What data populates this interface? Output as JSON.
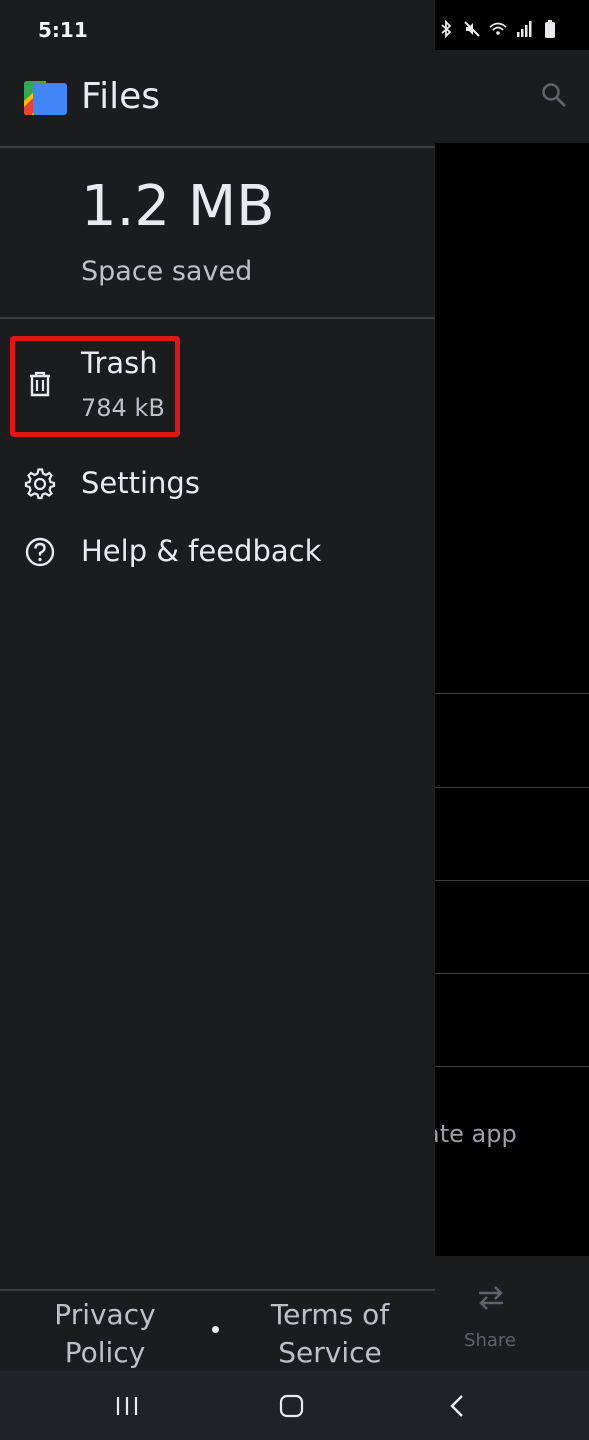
{
  "status_bar": {
    "time": "5:11",
    "icons": [
      "bluetooth-icon",
      "mute-icon",
      "wifi-icon",
      "signal-icon",
      "battery-icon"
    ]
  },
  "drawer": {
    "app_title": "Files",
    "storage": {
      "value": "1.2 MB",
      "label": "Space saved"
    },
    "items": [
      {
        "icon": "trash-icon",
        "label": "Trash",
        "sublabel": "784 kB"
      },
      {
        "icon": "settings-gear-icon",
        "label": "Settings"
      },
      {
        "icon": "help-circle-icon",
        "label": "Help & feedback"
      }
    ],
    "footer": {
      "privacy": "Privacy Policy",
      "terms": "Terms of Service"
    }
  },
  "background_app": {
    "partial_text": "ate app",
    "share_label": "Share"
  },
  "colors": {
    "drawer_bg": "#1a1c1e",
    "highlight": "#e4141d",
    "nav_bar": "#202326"
  }
}
